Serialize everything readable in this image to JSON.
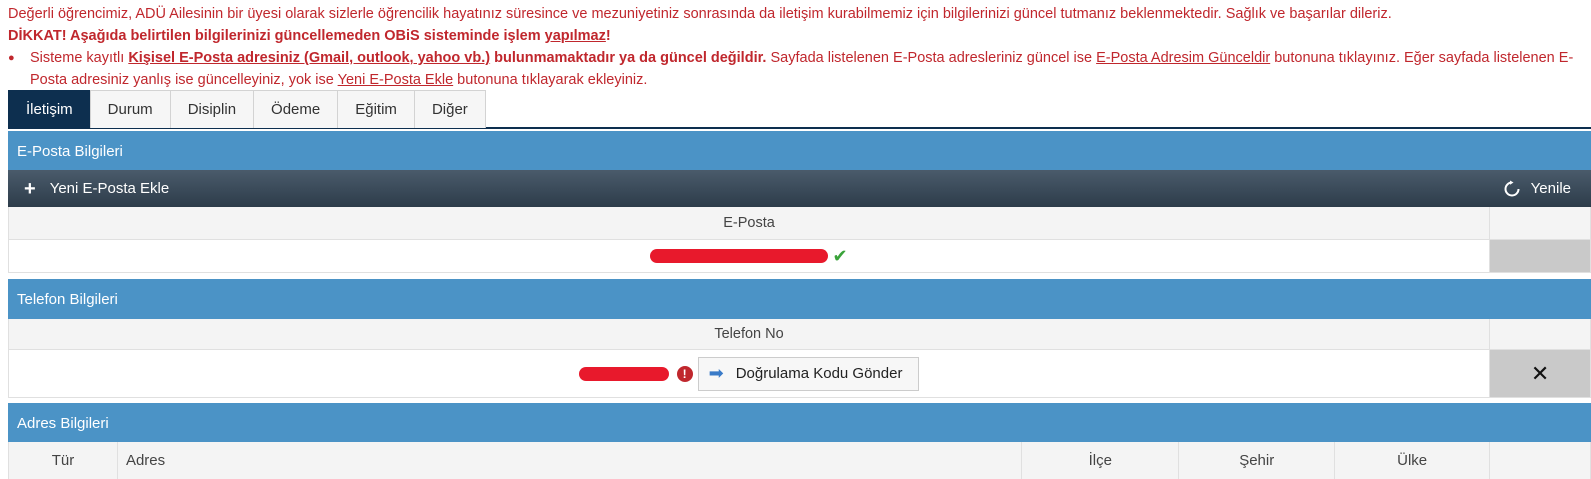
{
  "notice": {
    "line1": "Değerli öğrencimiz, ADÜ Ailesinin bir üyesi olarak sizlerle öğrencilik hayatınız süresince ve mezuniyetiniz sonrasında da iletişim kurabilmemiz için bilgilerinizi güncel tutmanız beklenmektedir. Sağlık ve başarılar dileriz.",
    "line2_bold": "DİKKAT! Aşağıda belirtilen bilgilerinizi güncellemeden OBiS sisteminde işlem ",
    "line2_link": "yapılmaz",
    "line2_end": "!",
    "bullet_a": "Sisteme kayıtlı ",
    "bullet_b_link": "Kişisel E-Posta adresiniz (Gmail, outlook, yahoo vb.)",
    "bullet_c_bold": " bulunmamaktadır ya da güncel değildir.",
    "bullet_d": " Sayfada listelenen E-Posta adresleriniz güncel ise ",
    "bullet_e_link": "E-Posta Adresim Günceldir",
    "bullet_f": " butonuna tıklayınız. Eğer sayfada listelenen E-Posta adresiniz yanlış ise güncelleyiniz, yok ise ",
    "bullet_g_link": "Yeni E-Posta Ekle",
    "bullet_h": " butonuna tıklayarak ekleyiniz."
  },
  "tabs": [
    {
      "label": "İletişim",
      "active": true
    },
    {
      "label": "Durum"
    },
    {
      "label": "Disiplin"
    },
    {
      "label": "Ödeme"
    },
    {
      "label": "Eğitim"
    },
    {
      "label": "Diğer"
    }
  ],
  "email_section": {
    "title": "E-Posta Bilgileri",
    "add_label": "Yeni E-Posta Ekle",
    "refresh_label": "Yenile",
    "column": "E-Posta"
  },
  "phone_section": {
    "title": "Telefon Bilgileri",
    "column": "Telefon No",
    "verify_label": "Doğrulama Kodu Gönder"
  },
  "address_section": {
    "title": "Adres Bilgileri",
    "columns": [
      "Tür",
      "Adres",
      "İlçe",
      "Şehir",
      "Ülke"
    ]
  },
  "colors": {
    "notice_red": "#c0272d",
    "tab_active": "#0d2f4f",
    "panel_blue": "#4b93c6",
    "redaction": "#e8192c"
  }
}
